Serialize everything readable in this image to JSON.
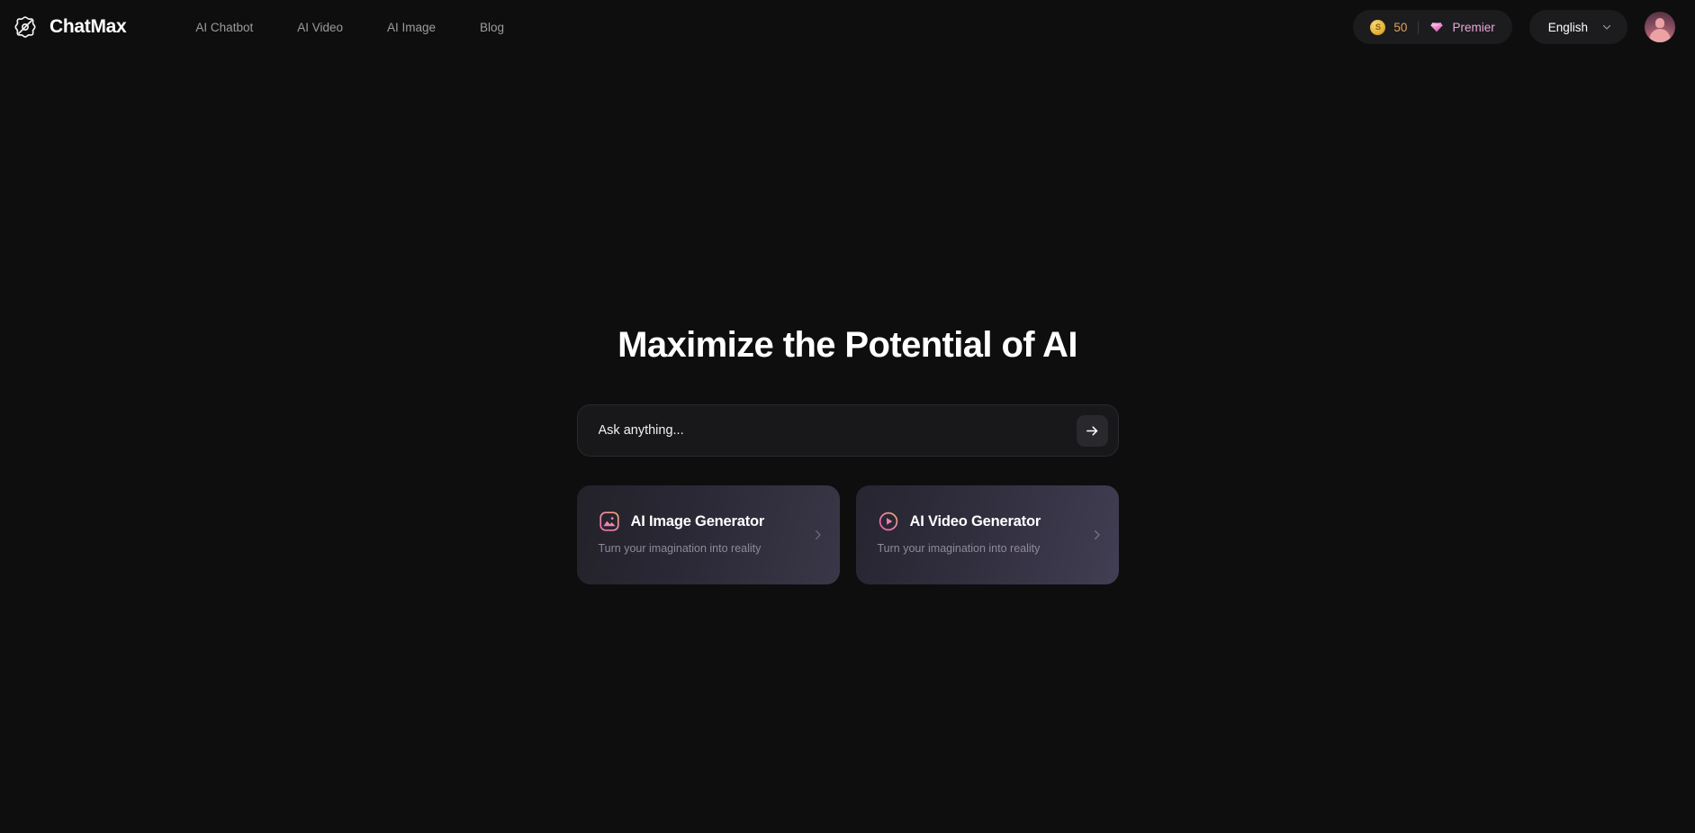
{
  "brand": {
    "name": "ChatMax",
    "logo_icon": "atom-logo-icon"
  },
  "nav": {
    "items": [
      {
        "label": "AI Chatbot",
        "name": "nav-link-ai-chatbot"
      },
      {
        "label": "AI Video",
        "name": "nav-link-ai-video"
      },
      {
        "label": "AI Image",
        "name": "nav-link-ai-image"
      },
      {
        "label": "Blog",
        "name": "nav-link-blog"
      }
    ]
  },
  "header_right": {
    "credits": {
      "coin_icon": "coin-icon",
      "coin_glyph": "S",
      "count": "50",
      "gem_icon": "gem-icon",
      "plan_label": "Premier"
    },
    "language": {
      "selected": "English",
      "chevron_icon": "chevron-down-icon"
    },
    "avatar": {
      "name": "user-avatar"
    }
  },
  "main": {
    "title": "Maximize the Potential of AI",
    "ask": {
      "placeholder": "Ask anything...",
      "value": "",
      "send_icon": "arrow-right-icon"
    },
    "cards": [
      {
        "title": "AI Image Generator",
        "subtitle": "Turn your imagination into reality",
        "icon": "image-icon",
        "chevron": "chevron-right-icon"
      },
      {
        "title": "AI Video Generator",
        "subtitle": "Turn your imagination into reality",
        "icon": "play-circle-icon",
        "chevron": "chevron-right-icon"
      }
    ]
  },
  "colors": {
    "background": "#0e0e0f",
    "pill_background": "#1c1c1e",
    "credits_text": "#e0a35c",
    "plan_text": "#e9a8d8",
    "nav_text": "#9c9ca0",
    "card_accent_start": "#ef7fb4",
    "card_accent_end": "#f0a368"
  }
}
